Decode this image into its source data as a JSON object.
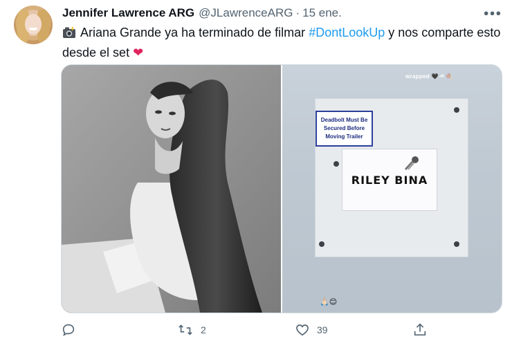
{
  "tweet": {
    "author_name": "Jennifer Lawrence ARG",
    "handle": "@JLawrenceARG",
    "separator": "·",
    "date": "15 ene.",
    "text_part1": "Ariana Grande ya ha terminado de filmar",
    "hashtag": "#DontLookUp",
    "text_part2": "y nos comparte esto desde el set",
    "heart_emoji": "❤",
    "camera_emoji_icon": "camera-flash-icon"
  },
  "media": {
    "right_photo": {
      "story_tag": "wrapped 🖤☁️🍭",
      "sticker_lines": [
        "Deadbolt Must Be",
        "Secured Before",
        "Moving Trailer"
      ],
      "nameplate_text": "RILEY BINA",
      "bottom_emoji": "🙏🏻😊"
    }
  },
  "actions": {
    "reply_icon": "reply-icon",
    "retweet_icon": "retweet-icon",
    "retweet_count": "2",
    "like_icon": "heart-icon",
    "like_count": "39",
    "share_icon": "share-icon"
  },
  "colors": {
    "link": "#1d9bf0",
    "secondary_text": "#536471",
    "heart": "#e0245e",
    "border": "#cfd9de"
  }
}
